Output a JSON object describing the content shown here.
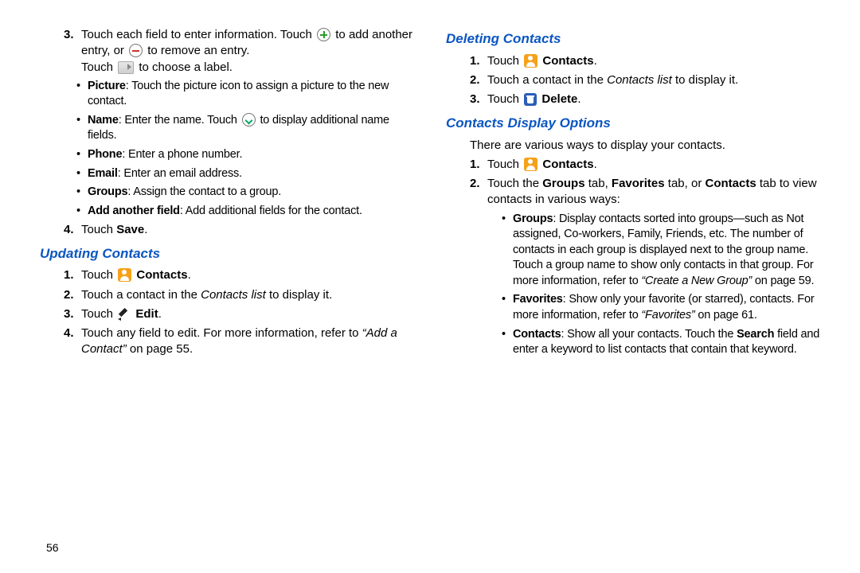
{
  "page_number": "56",
  "left": {
    "step3": {
      "num": "3.",
      "line1a": "Touch each field to enter information. Touch ",
      "line1b": " to",
      "line2a": "add another entry, or ",
      "line2b": " to remove an entry.",
      "line3a": "Touch ",
      "line3b": " to choose a label."
    },
    "bullets": {
      "picture_b": "Picture",
      "picture": ": Touch the picture icon to assign a picture to the new contact.",
      "name_b": "Name",
      "name_a": ": Enter the name. Touch ",
      "name_c": " to display additional name fields.",
      "phone_b": "Phone",
      "phone": ": Enter a phone number.",
      "email_b": "Email",
      "email": ": Enter an email address.",
      "groups_b": "Groups",
      "groups": ": Assign the contact to a group.",
      "addf_b": "Add another field",
      "addf": ": Add additional fields for the contact."
    },
    "step4": {
      "num": "4.",
      "a": "Touch ",
      "b": "Save",
      "c": "."
    },
    "h_update": "Updating Contacts",
    "u1": {
      "num": "1.",
      "a": "Touch ",
      "b": "Contacts",
      "c": "."
    },
    "u2": {
      "num": "2.",
      "a": "Touch a contact in the ",
      "b": "Contacts list",
      "c": " to display it."
    },
    "u3": {
      "num": "3.",
      "a": "Touch ",
      "b": "Edit",
      "c": "."
    },
    "u4": {
      "num": "4.",
      "a": "Touch any field to edit. For more information, refer to ",
      "b": "“Add a Contact”",
      "c": " on page 55."
    }
  },
  "right": {
    "h_delete": "Deleting Contacts",
    "d1": {
      "num": "1.",
      "a": "Touch ",
      "b": "Contacts",
      "c": "."
    },
    "d2": {
      "num": "2.",
      "a": "Touch a contact in the ",
      "b": "Contacts list",
      "c": " to display it."
    },
    "d3": {
      "num": "3.",
      "a": "Touch ",
      "b": "Delete",
      "c": "."
    },
    "h_disp": "Contacts Display Options",
    "intro": "There are various ways to display your contacts.",
    "c1": {
      "num": "1.",
      "a": "Touch ",
      "b": "Contacts",
      "c": "."
    },
    "c2": {
      "num": "2.",
      "a": "Touch the ",
      "g": "Groups",
      "t1": " tab, ",
      "f": "Favorites",
      "t2": " tab, or ",
      "cc": "Contacts",
      "t3": " tab to view contacts in various ways:"
    },
    "b_groups_b": "Groups",
    "b_groups_a": ": Display contacts sorted into groups—such as Not assigned, Co-workers, Family, Friends, etc. The number of contacts in each group is displayed next to the group name. Touch a group name to show only contacts in that group. For more information, refer to ",
    "b_groups_i": "“Create a New Group”",
    "b_groups_c": " on page 59.",
    "b_fav_b": "Favorites",
    "b_fav_a": ": Show only your favorite (or starred), contacts. For more information, refer to ",
    "b_fav_i": "“Favorites”",
    "b_fav_c": " on page 61.",
    "b_con_b": "Contacts",
    "b_con_a": ": Show all your contacts. Touch the ",
    "b_con_s": "Search",
    "b_con_c": " field and enter a keyword to list contacts that contain that keyword."
  }
}
